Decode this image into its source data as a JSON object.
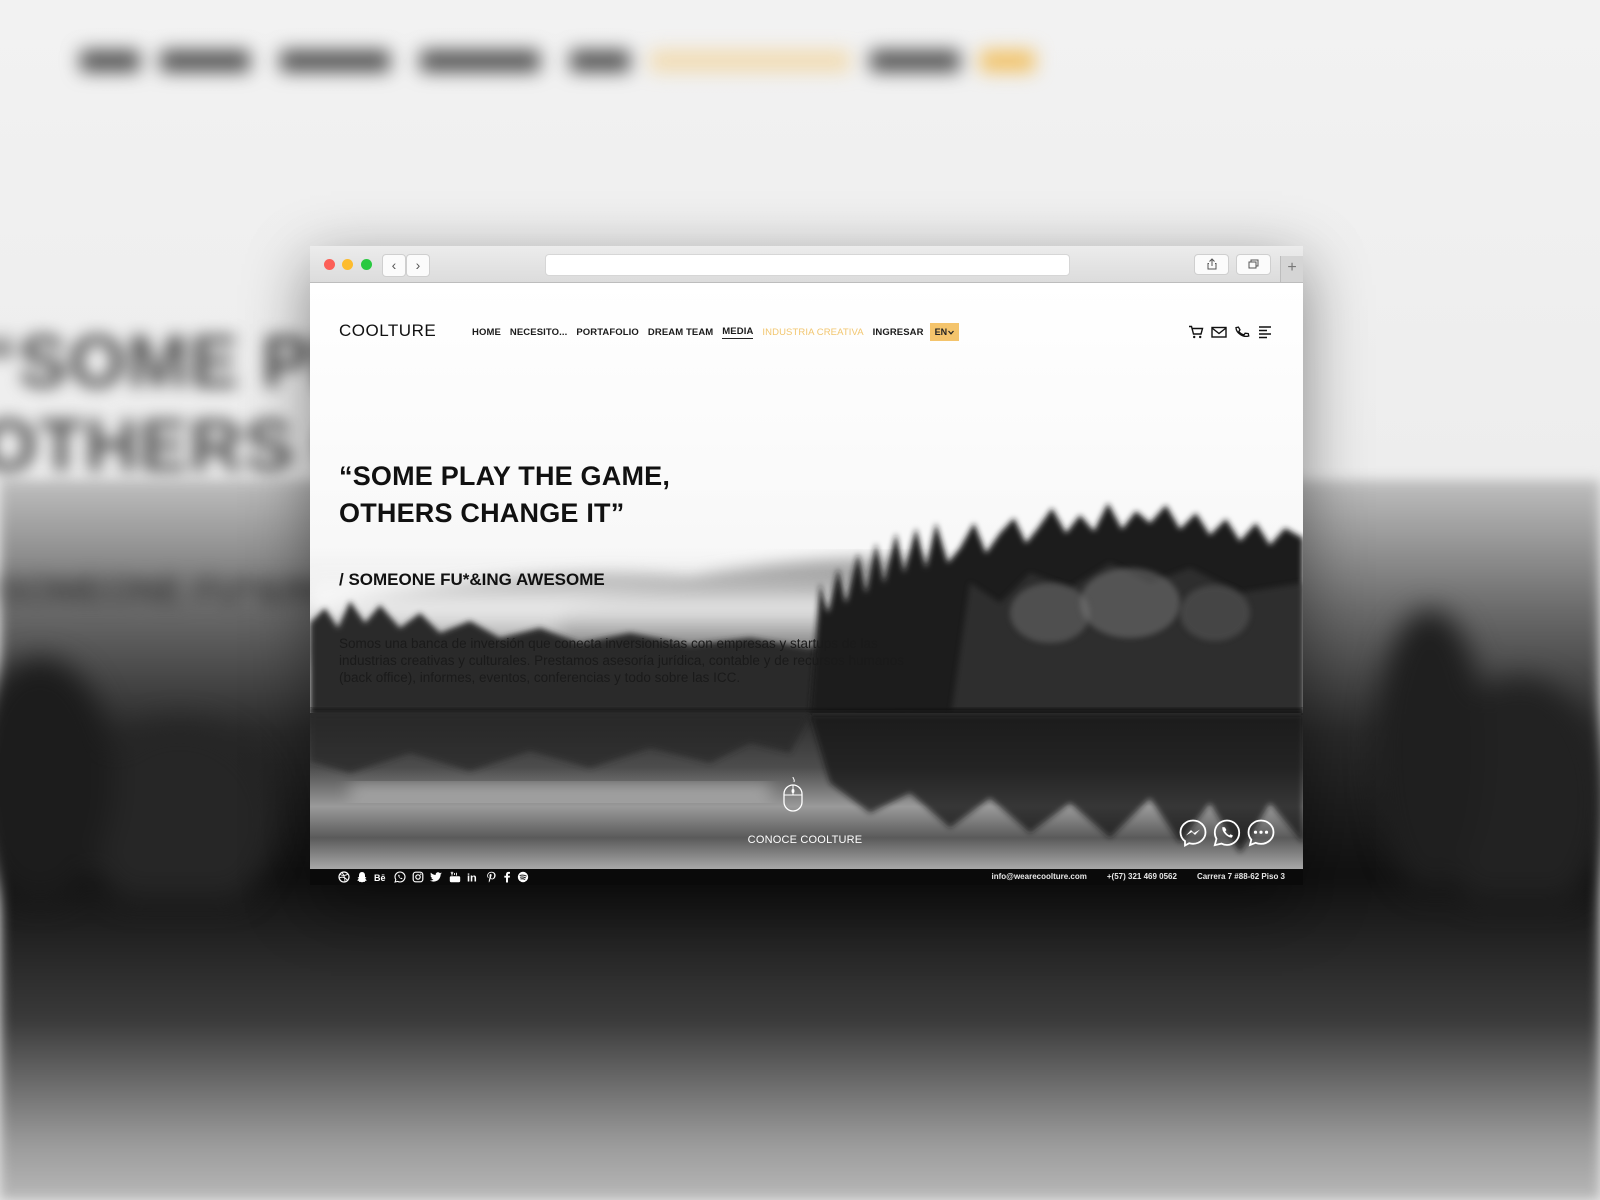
{
  "browser": {
    "back_symbol": "‹",
    "forward_symbol": "›",
    "url": "",
    "share_icon": "share-icon",
    "tabs_icon": "tabs-icon",
    "new_tab_symbol": "+"
  },
  "site": {
    "logo": "COOLTURE",
    "nav": [
      "HOME",
      "NECESITO...",
      "PORTAFOLIO",
      "DREAM TEAM",
      "MEDIA",
      "INDUSTRIA CREATIVA",
      "INGRESAR"
    ],
    "active_nav": "MEDIA",
    "highlight_nav": "INDUSTRIA CREATIVA",
    "language": "EN",
    "header_icons": [
      "cart-icon",
      "mail-icon",
      "phone-icon",
      "menu-icon"
    ]
  },
  "hero": {
    "quote_line1": "“SOME PLAY THE GAME,",
    "quote_line2": "OTHERS CHANGE IT”",
    "attribution": "/ SOMEONE FU*&ING AWESOME",
    "description": "Somos una banca de inversión que conecta inversionistas con empresas y startups de las industrias creativas y culturales. Prestamos asesoría jurídica, contable y de recursos humanos (back office), informes, eventos, conferencias y todo sobre las ICC.",
    "cta": "CONOCE COOLTURE"
  },
  "chat_icons": [
    "messenger-icon",
    "whatsapp-icon",
    "chat-icon"
  ],
  "footer": {
    "social_icons": [
      "dribbble-icon",
      "snapchat-icon",
      "behance-icon",
      "whatsapp-icon",
      "instagram-icon",
      "twitter-icon",
      "youtube-icon",
      "linkedin-icon",
      "pinterest-icon",
      "facebook-icon",
      "spotify-icon"
    ],
    "email": "info@wearecoolture.com",
    "phone": "+(57) 321 469 0562",
    "address": "Carrera 7 #88-62 Piso 3"
  },
  "colors": {
    "accent": "#f4c46c",
    "text": "#111111",
    "footer_bg": "#0a0a0a"
  }
}
